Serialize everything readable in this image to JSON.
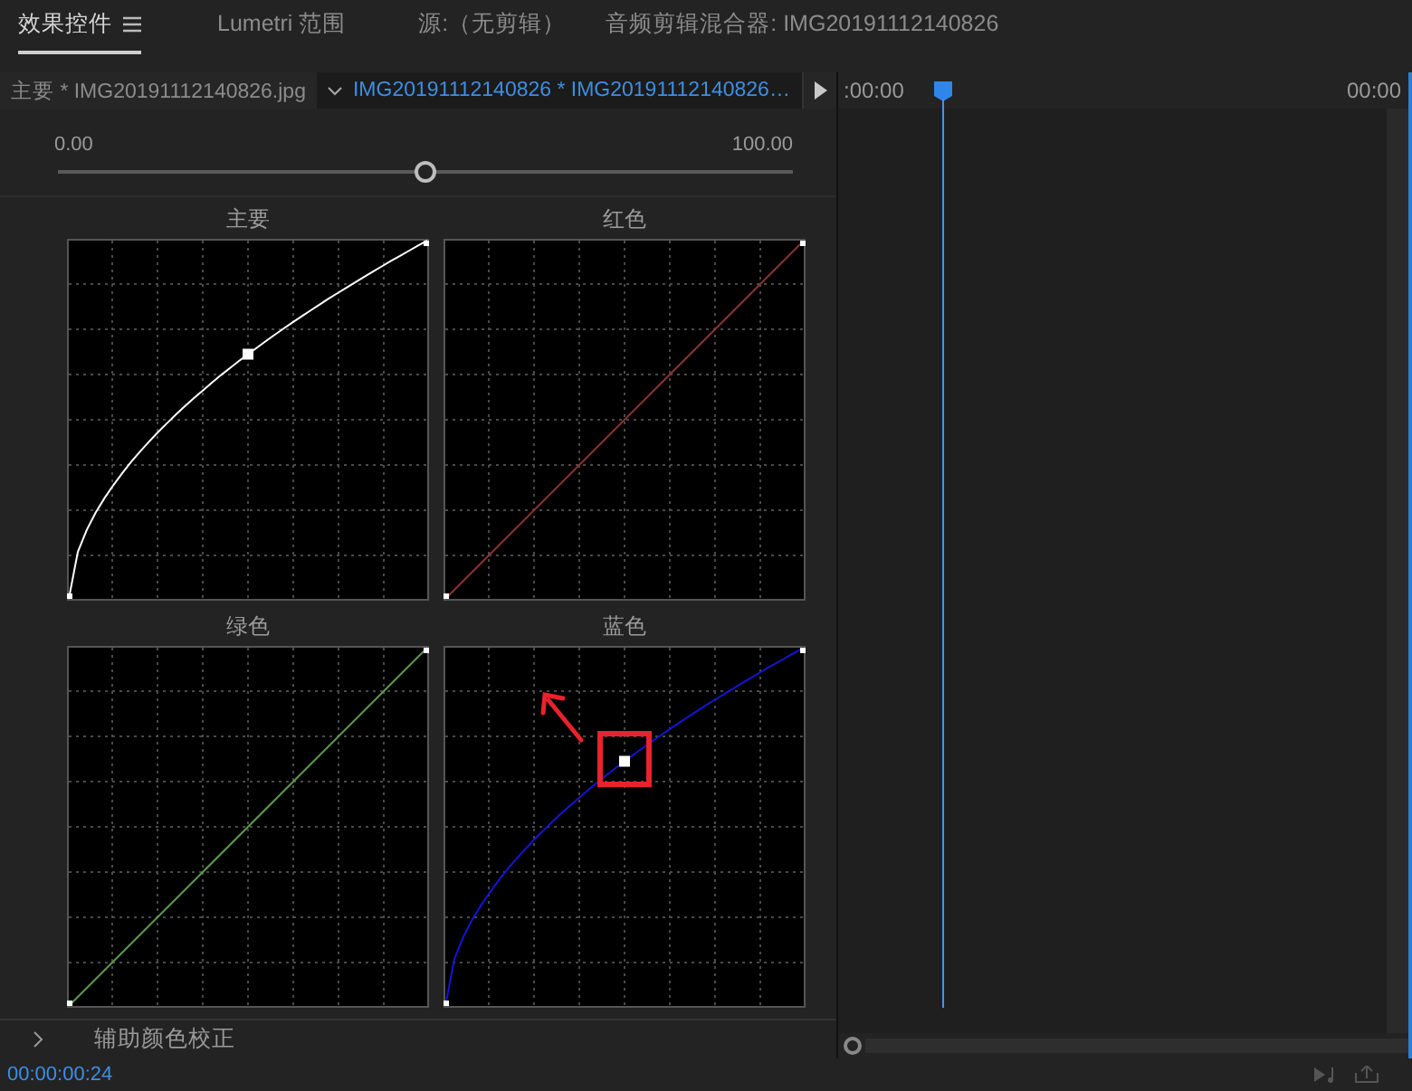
{
  "panel_tabs": [
    {
      "label": "效果控件",
      "selected": true,
      "menu": true
    },
    {
      "label": "Lumetri 范围",
      "selected": false,
      "menu": false
    },
    {
      "label": "源:（无剪辑）",
      "selected": false,
      "menu": false
    },
    {
      "label": "音频剪辑混合器: IMG20191112140826",
      "selected": false,
      "menu": false
    }
  ],
  "clip_tabs": [
    {
      "label": "主要 * IMG20191112140826.jpg",
      "selected": false
    },
    {
      "label": "IMG20191112140826 * IMG20191112140826…",
      "selected": true
    }
  ],
  "slider": {
    "min_label": "0.00",
    "max_label": "100.00",
    "level": 0.5
  },
  "curves": [
    {
      "title": "主要",
      "kind": "curve",
      "color": "#ffffff"
    },
    {
      "title": "红色",
      "kind": "linear",
      "color": "#8a3232"
    },
    {
      "title": "绿色",
      "kind": "linear",
      "color": "#5e9a4c"
    },
    {
      "title": "蓝色",
      "kind": "curve",
      "color": "#1414d8"
    }
  ],
  "section": {
    "label": "辅助颜色校正",
    "expanded": false
  },
  "timeline": {
    "start_time": ":00:00",
    "end_time": "00:00"
  },
  "timecode": "00:00:00:24"
}
